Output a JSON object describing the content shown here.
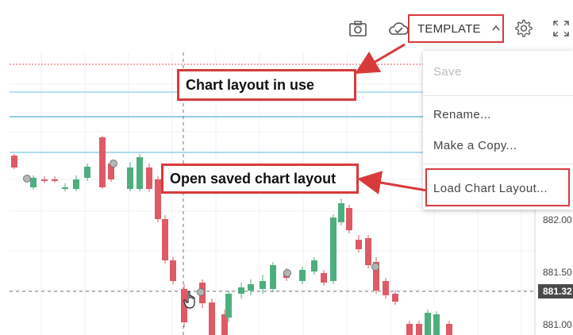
{
  "toolbar": {
    "template_label": "TEMPLATE",
    "icons": [
      "camera-icon",
      "cloud-check-icon",
      "chevron-up-icon",
      "gear-icon",
      "fullscreen-icon"
    ]
  },
  "menu": {
    "items": [
      {
        "label": "Save",
        "enabled": false
      },
      {
        "label": "Rename...",
        "enabled": true
      },
      {
        "label": "Make a Copy...",
        "enabled": true
      },
      {
        "label": "Load Chart Layout...",
        "enabled": true
      }
    ]
  },
  "callouts": {
    "in_use": "Chart layout in use",
    "open_saved": "Open saved chart layout"
  },
  "price_axis": {
    "labels": [
      "882.00",
      "881.50",
      "881.32",
      "881.00"
    ],
    "current_price": "881.32"
  },
  "colors": {
    "accent_red": "#d83a3a",
    "bull": "#4caf7d",
    "bear": "#dd5a66",
    "hline": "#8fd0e4"
  }
}
